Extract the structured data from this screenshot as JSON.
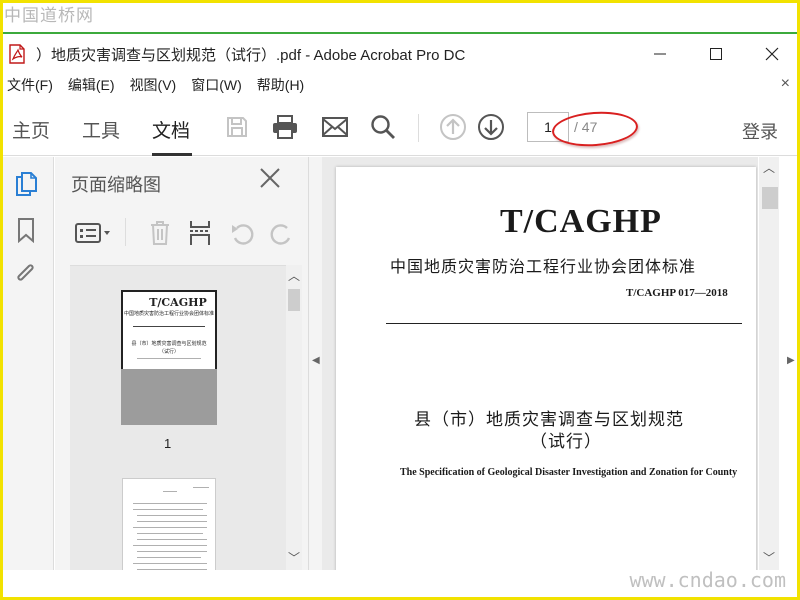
{
  "watermark": {
    "top": "中国道桥网",
    "bottom": "www.cndao.com"
  },
  "window": {
    "title": "）地质灾害调查与区划规范（试行）.pdf - Adobe Acrobat Pro DC",
    "icon": "pdf-file-icon",
    "controls": {
      "minimize": "—",
      "maximize": "☐",
      "close": "✕"
    }
  },
  "menu": {
    "items": [
      "文件(F)",
      "编辑(E)",
      "视图(V)",
      "窗口(W)",
      "帮助(H)"
    ],
    "close": "×"
  },
  "toolbar": {
    "tabs": [
      "主页",
      "工具",
      "文档"
    ],
    "active_tab": "文档",
    "icons": [
      "save-icon",
      "print-icon",
      "email-icon",
      "search-icon",
      "prev-page-icon",
      "next-page-icon"
    ],
    "page_current": "1",
    "page_total": "/ 47",
    "signin": "登录"
  },
  "left_rail": {
    "icons": [
      "page-thumbnails-icon",
      "bookmark-icon",
      "attachment-icon"
    ]
  },
  "thumb_panel": {
    "title": "页面缩略图",
    "close": "✕",
    "tools": [
      "options-icon",
      "delete-icon",
      "insert-page-icon",
      "rotate-left-icon",
      "rotate-right-icon"
    ],
    "thumb1": {
      "code": "T/CAGHP",
      "org": "中国地质灾害防治工程行业协会团体标准",
      "title": "县（市）地质灾害调查与区划规范",
      "subtitle": "（试行）",
      "label": "1"
    }
  },
  "document": {
    "code": "T/CAGHP",
    "org": "中国地质灾害防治工程行业协会团体标准",
    "number": "T/CAGHP 017—2018",
    "title_line1": "县（市）地质灾害调查与区划规范",
    "title_line2": "（试行）",
    "english_title": "The Specification of Geological Disaster Investigation and Zonation for County"
  },
  "colors": {
    "accent_blue": "#2a7fd4",
    "annotation_red": "#d92020",
    "frame_yellow": "#f2e200",
    "watermark_line_green": "#3caa3c"
  }
}
